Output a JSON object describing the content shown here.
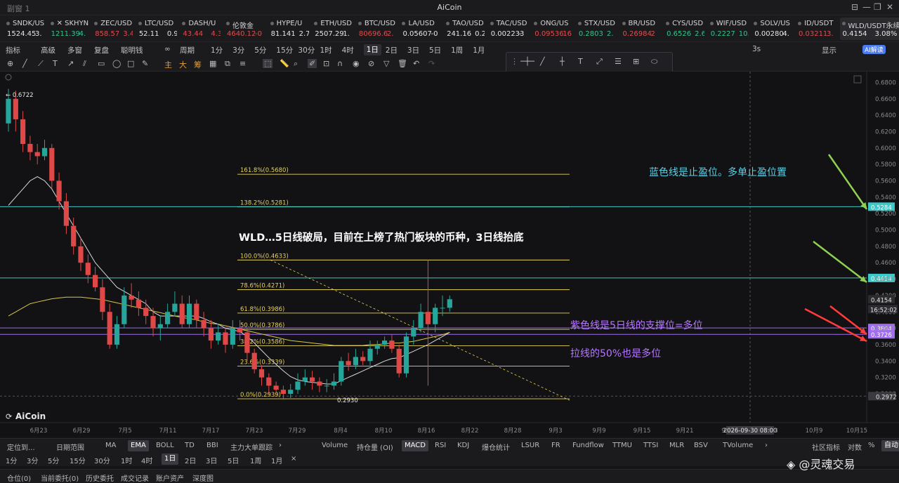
{
  "window": {
    "left_title": "副窗 1",
    "title": "AiCoin",
    "btns": [
      "⊟",
      "—",
      "❐",
      "✕"
    ]
  },
  "tickers": [
    {
      "sym": "SNDK/US",
      "price": "1524.45",
      "chg": "3.",
      "dir": "wh"
    },
    {
      "sym": "✕ SKHYNI",
      "price": "1211.39",
      "chg": "4.",
      "dir": "up"
    },
    {
      "sym": "ZEC/USD",
      "price": "858.57",
      "chg": "3.4",
      "dir": "dn"
    },
    {
      "sym": "LTC/USD",
      "price": "52.11",
      "chg": "0.97",
      "dir": "wh"
    },
    {
      "sym": "DASH/U",
      "price": "43.44",
      "chg": "4.37",
      "dir": "dn"
    },
    {
      "sym": "伦敦金",
      "price": "4640.12",
      "chg": "-0",
      "dir": "dn"
    },
    {
      "sym": "HYPE/U",
      "price": "81.141",
      "chg": "2.7",
      "dir": "wh"
    },
    {
      "sym": "ETH/USD",
      "price": "2507.29",
      "chg": "1.",
      "dir": "wh"
    },
    {
      "sym": "BTC/USD",
      "price": "80696.6",
      "chg": "2.",
      "dir": "dn"
    },
    {
      "sym": "LA/USD",
      "price": "0.05607",
      "chg": "-0",
      "dir": "wh"
    },
    {
      "sym": "TAO/USD",
      "price": "241.16",
      "chg": "0.2",
      "dir": "wh"
    },
    {
      "sym": "TAC/USD",
      "price": "0.002233",
      "chg": "-",
      "dir": "wh"
    },
    {
      "sym": "ONG/US",
      "price": "0.09536",
      "chg": "16",
      "dir": "dn"
    },
    {
      "sym": "STX/USD",
      "price": "0.2803",
      "chg": "2.",
      "dir": "up"
    },
    {
      "sym": "BR/USD",
      "price": "0.26984",
      "chg": "2",
      "dir": "dn"
    },
    {
      "sym": "CYS/USD",
      "price": "0.6526",
      "chg": "2.6",
      "dir": "up"
    },
    {
      "sym": "WIF/USD",
      "price": "0.2227",
      "chg": "10.",
      "dir": "up"
    },
    {
      "sym": "SOLV/US",
      "price": "0.00280",
      "chg": "4.",
      "dir": "wh"
    },
    {
      "sym": "ID/USDT",
      "price": "0.03211",
      "chg": "3.",
      "dir": "dn"
    },
    {
      "sym": "WLD/USDT永续",
      "price": "0.4154",
      "chg": "3.08%",
      "dir": "wh",
      "active": true
    }
  ],
  "toolbar": {
    "items": [
      "指标",
      "高级",
      "多窗",
      "复盘",
      "聪明钱",
      "∞"
    ],
    "period_label": "周期",
    "periods": [
      "1分",
      "3分",
      "5分",
      "15分",
      "30分",
      "1时",
      "4时",
      "1日",
      "2日",
      "3日",
      "5日",
      "1周",
      "1月"
    ],
    "selected_period": "1日",
    "right": [
      "3s",
      "显示",
      "AI解读"
    ]
  },
  "chart_data": {
    "type": "candlestick",
    "title": "WLD…5日线破局，目前在上榜了热门板块的币种，3日线抬底",
    "x_ticks": [
      "6月23",
      "6月29",
      "7月5",
      "7月11",
      "7月17",
      "7月23",
      "7月29",
      "8月4",
      "8月10",
      "8月16",
      "8月22",
      "8月28",
      "9月3",
      "9月9",
      "9月15",
      "9月21",
      "9",
      "2026-09-30 08:00",
      "3",
      "10月9",
      "10月15"
    ],
    "y_ticks": [
      "0.6800",
      "0.6600",
      "0.6400",
      "0.6200",
      "0.6000",
      "0.5800",
      "0.5600",
      "0.5400",
      "0.5200",
      "0.5000",
      "0.4800",
      "0.4600",
      "0.4400",
      "0.4200",
      "0.4000",
      "0.3800",
      "0.3600",
      "0.3400",
      "0.3200",
      "0.3000"
    ],
    "ylim": [
      0.282,
      0.6932
    ],
    "high_label": "← 0.6722",
    "low_label": "0.2930",
    "candles": [
      [
        0.63,
        0.66,
        0.6722,
        0.62
      ],
      [
        0.66,
        0.635,
        0.67,
        0.62
      ],
      [
        0.635,
        0.605,
        0.645,
        0.595
      ],
      [
        0.605,
        0.595,
        0.615,
        0.585
      ],
      [
        0.595,
        0.59,
        0.605,
        0.58
      ],
      [
        0.59,
        0.6,
        0.61,
        0.585
      ],
      [
        0.6,
        0.56,
        0.605,
        0.55
      ],
      [
        0.56,
        0.535,
        0.57,
        0.525
      ],
      [
        0.535,
        0.505,
        0.545,
        0.495
      ],
      [
        0.505,
        0.48,
        0.515,
        0.47
      ],
      [
        0.48,
        0.46,
        0.49,
        0.45
      ],
      [
        0.46,
        0.445,
        0.47,
        0.435
      ],
      [
        0.445,
        0.43,
        0.455,
        0.425
      ],
      [
        0.43,
        0.4,
        0.44,
        0.39
      ],
      [
        0.4,
        0.36,
        0.41,
        0.355
      ],
      [
        0.36,
        0.385,
        0.395,
        0.355
      ],
      [
        0.385,
        0.42,
        0.43,
        0.38
      ],
      [
        0.42,
        0.415,
        0.435,
        0.405
      ],
      [
        0.415,
        0.405,
        0.425,
        0.395
      ],
      [
        0.405,
        0.395,
        0.415,
        0.385
      ],
      [
        0.395,
        0.38,
        0.405,
        0.37
      ],
      [
        0.38,
        0.385,
        0.395,
        0.365
      ],
      [
        0.385,
        0.4,
        0.41,
        0.38
      ],
      [
        0.4,
        0.41,
        0.425,
        0.395
      ],
      [
        0.41,
        0.385,
        0.42,
        0.38
      ],
      [
        0.385,
        0.41,
        0.42,
        0.38
      ],
      [
        0.41,
        0.39,
        0.415,
        0.38
      ],
      [
        0.39,
        0.38,
        0.4,
        0.37
      ],
      [
        0.38,
        0.365,
        0.39,
        0.355
      ],
      [
        0.365,
        0.375,
        0.385,
        0.36
      ],
      [
        0.375,
        0.36,
        0.38,
        0.35
      ],
      [
        0.36,
        0.38,
        0.39,
        0.355
      ],
      [
        0.38,
        0.375,
        0.39,
        0.365
      ],
      [
        0.375,
        0.35,
        0.38,
        0.34
      ],
      [
        0.35,
        0.33,
        0.355,
        0.325
      ],
      [
        0.33,
        0.32,
        0.335,
        0.31
      ],
      [
        0.32,
        0.31,
        0.325,
        0.3
      ],
      [
        0.31,
        0.305,
        0.315,
        0.298
      ],
      [
        0.305,
        0.3,
        0.31,
        0.293
      ],
      [
        0.3,
        0.305,
        0.312,
        0.295
      ],
      [
        0.305,
        0.315,
        0.325,
        0.3
      ],
      [
        0.315,
        0.32,
        0.33,
        0.31
      ],
      [
        0.32,
        0.315,
        0.328,
        0.305
      ],
      [
        0.315,
        0.31,
        0.32,
        0.302
      ],
      [
        0.31,
        0.31,
        0.318,
        0.302
      ],
      [
        0.31,
        0.315,
        0.325,
        0.305
      ],
      [
        0.315,
        0.34,
        0.345,
        0.31
      ],
      [
        0.34,
        0.335,
        0.35,
        0.328
      ],
      [
        0.335,
        0.345,
        0.355,
        0.33
      ],
      [
        0.345,
        0.34,
        0.352,
        0.335
      ],
      [
        0.34,
        0.355,
        0.365,
        0.335
      ],
      [
        0.355,
        0.36,
        0.365,
        0.348
      ],
      [
        0.36,
        0.365,
        0.37,
        0.355
      ],
      [
        0.365,
        0.355,
        0.372,
        0.35
      ],
      [
        0.355,
        0.325,
        0.36,
        0.32
      ],
      [
        0.325,
        0.37,
        0.375,
        0.32
      ],
      [
        0.37,
        0.38,
        0.39,
        0.36
      ],
      [
        0.38,
        0.4,
        0.41,
        0.375
      ],
      [
        0.4,
        0.385,
        0.4633,
        0.31
      ],
      [
        0.385,
        0.405,
        0.41,
        0.375
      ],
      [
        0.405,
        0.405,
        0.42,
        0.395
      ],
      [
        0.405,
        0.4154,
        0.42,
        0.4
      ]
    ],
    "ma_white": [
      0.53,
      0.54,
      0.55,
      0.56,
      0.565,
      0.56,
      0.55,
      0.535,
      0.52,
      0.505,
      0.49,
      0.475,
      0.46,
      0.45,
      0.44,
      0.43,
      0.425,
      0.42,
      0.415,
      0.41,
      0.4,
      0.395,
      0.395,
      0.395,
      0.395,
      0.395,
      0.395,
      0.392,
      0.388,
      0.385,
      0.38,
      0.378,
      0.376,
      0.37,
      0.362,
      0.353,
      0.344,
      0.336,
      0.328,
      0.321,
      0.317,
      0.315,
      0.314,
      0.313,
      0.312,
      0.312,
      0.316,
      0.32,
      0.324,
      0.328,
      0.332,
      0.336,
      0.34,
      0.343,
      0.344,
      0.348,
      0.352,
      0.356,
      0.36,
      0.365,
      0.37,
      0.375
    ],
    "ma_yellow": [
      0.395,
      0.4,
      0.405,
      0.41,
      0.412,
      0.414,
      0.416,
      0.417,
      0.418,
      0.418,
      0.418,
      0.417,
      0.416,
      0.415,
      0.413,
      0.411,
      0.409,
      0.407,
      0.405,
      0.403,
      0.401,
      0.399,
      0.397,
      0.395,
      0.393,
      0.392,
      0.39,
      0.388,
      0.386,
      0.385,
      0.383,
      0.381,
      0.379,
      0.377,
      0.375,
      0.373,
      0.371,
      0.369,
      0.367,
      0.365,
      0.364,
      0.363,
      0.362,
      0.361,
      0.36,
      0.359,
      0.359,
      0.359,
      0.359,
      0.359,
      0.36,
      0.36,
      0.361,
      0.362,
      0.362,
      0.363,
      0.364,
      0.366,
      0.368,
      0.37,
      0.372,
      0.375
    ],
    "fib_levels": [
      {
        "label": "161.8%(0.5680)",
        "value": 0.568
      },
      {
        "label": "138.2%(0.5281)",
        "value": 0.5281
      },
      {
        "label": "100.0%(0.4633)",
        "value": 0.4633
      },
      {
        "label": "78.6%(0.4271)",
        "value": 0.4271
      },
      {
        "label": "61.8%(0.3986)",
        "value": 0.3986
      },
      {
        "label": "50.0%(0.3786)",
        "value": 0.3786
      },
      {
        "label": "38.2%(0.3586)",
        "value": 0.3586
      },
      {
        "label": "23.6%(0.3339)",
        "value": 0.3339
      },
      {
        "label": "0.0%(0.2939)",
        "value": 0.2939
      }
    ],
    "hlines": [
      {
        "value": 0.5284,
        "color": "#3ec7c7",
        "tag": "0.5284"
      },
      {
        "value": 0.4414,
        "color": "#3ec7c7",
        "tag": "0.4414"
      },
      {
        "value": 0.3804,
        "color": "#a06cf0",
        "tag": "0.3804"
      },
      {
        "value": 0.3726,
        "color": "#a06cf0",
        "tag": "0.3726"
      }
    ],
    "current_price": "0.4154",
    "countdown": "16:52:02",
    "crosshair_tag": "0.2972",
    "annotations": [
      {
        "text": "蓝色线是止盈位。多单止盈位置",
        "color": "#5ad1e6"
      },
      {
        "text": "紫色线是5日线的支撑位=多位",
        "color": "#b678ff"
      },
      {
        "text": "拉线的50%也是多位",
        "color": "#b678ff"
      }
    ],
    "logo": "AiCoin"
  },
  "bottom": {
    "row1": [
      "定位到...",
      "日期范围",
      "MA",
      "EMA",
      "BOLL",
      "TD",
      "BBI",
      "主力大单跟踪",
      "›",
      "Volume",
      "持仓量 (OI)",
      "MACD",
      "RSI",
      "KDJ",
      "爆仓统计",
      "LSUR",
      "FR",
      "Fundflow",
      "TTMU",
      "TTSI",
      "MLR",
      "BSV",
      "TVolume",
      "›",
      "社区指标",
      "对数",
      "%",
      "自动"
    ],
    "row2": [
      "1分",
      "3分",
      "5分",
      "15分",
      "30分",
      "1时",
      "4时",
      "1日",
      "2日",
      "3日",
      "5日",
      "1周",
      "1月",
      "×"
    ],
    "row3": [
      "仓位(0)",
      "当前委托(0)",
      "历史委托",
      "成交记录",
      "账户资产",
      "深度图"
    ]
  },
  "watermark": "◈ @灵魂交易"
}
